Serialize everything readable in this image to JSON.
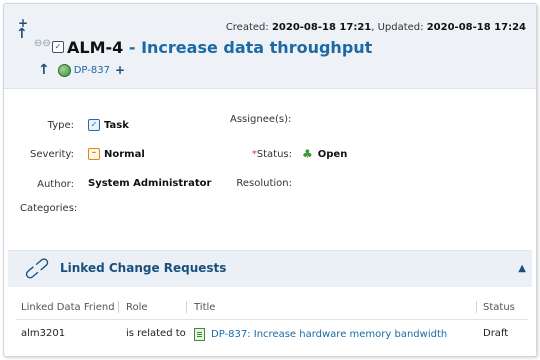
{
  "header": {
    "created_label": "Created:",
    "created_value": "2020-08-18 17:21",
    "updated_label": "Updated:",
    "updated_value": "2020-08-18 17:24",
    "item_key": "ALM-4",
    "title_separator": "-",
    "item_summary": "Increase data throughput",
    "parent_link": "DP-837",
    "icons": [
      "add-icon",
      "move-up-icon",
      "link-icon",
      "task-icon",
      "globe-icon",
      "plus-icon"
    ]
  },
  "fields": {
    "type_label": "Type:",
    "type_value": "Task",
    "severity_label": "Severity:",
    "severity_value": "Normal",
    "author_label": "Author:",
    "author_value": "System Administrator",
    "categories_label": "Categories:",
    "assignees_label": "Assignee(s):",
    "status_required_marker": "*",
    "status_label": "Status:",
    "status_value": "Open",
    "resolution_label": "Resolution:"
  },
  "linked_section": {
    "title": "Linked Change Requests",
    "columns": [
      "Linked Data Friend",
      "Role",
      "Title",
      "Status"
    ],
    "rows": [
      {
        "friend": "alm3201",
        "role": "is related to",
        "title": "DP-837: Increase hardware memory bandwidth",
        "status": "Draft"
      }
    ]
  },
  "colors": {
    "accent": "#1b6aa5",
    "header_bg": "#eef2f6",
    "section_bg": "#eaf0f5",
    "open_status": "#3a9a3a"
  }
}
